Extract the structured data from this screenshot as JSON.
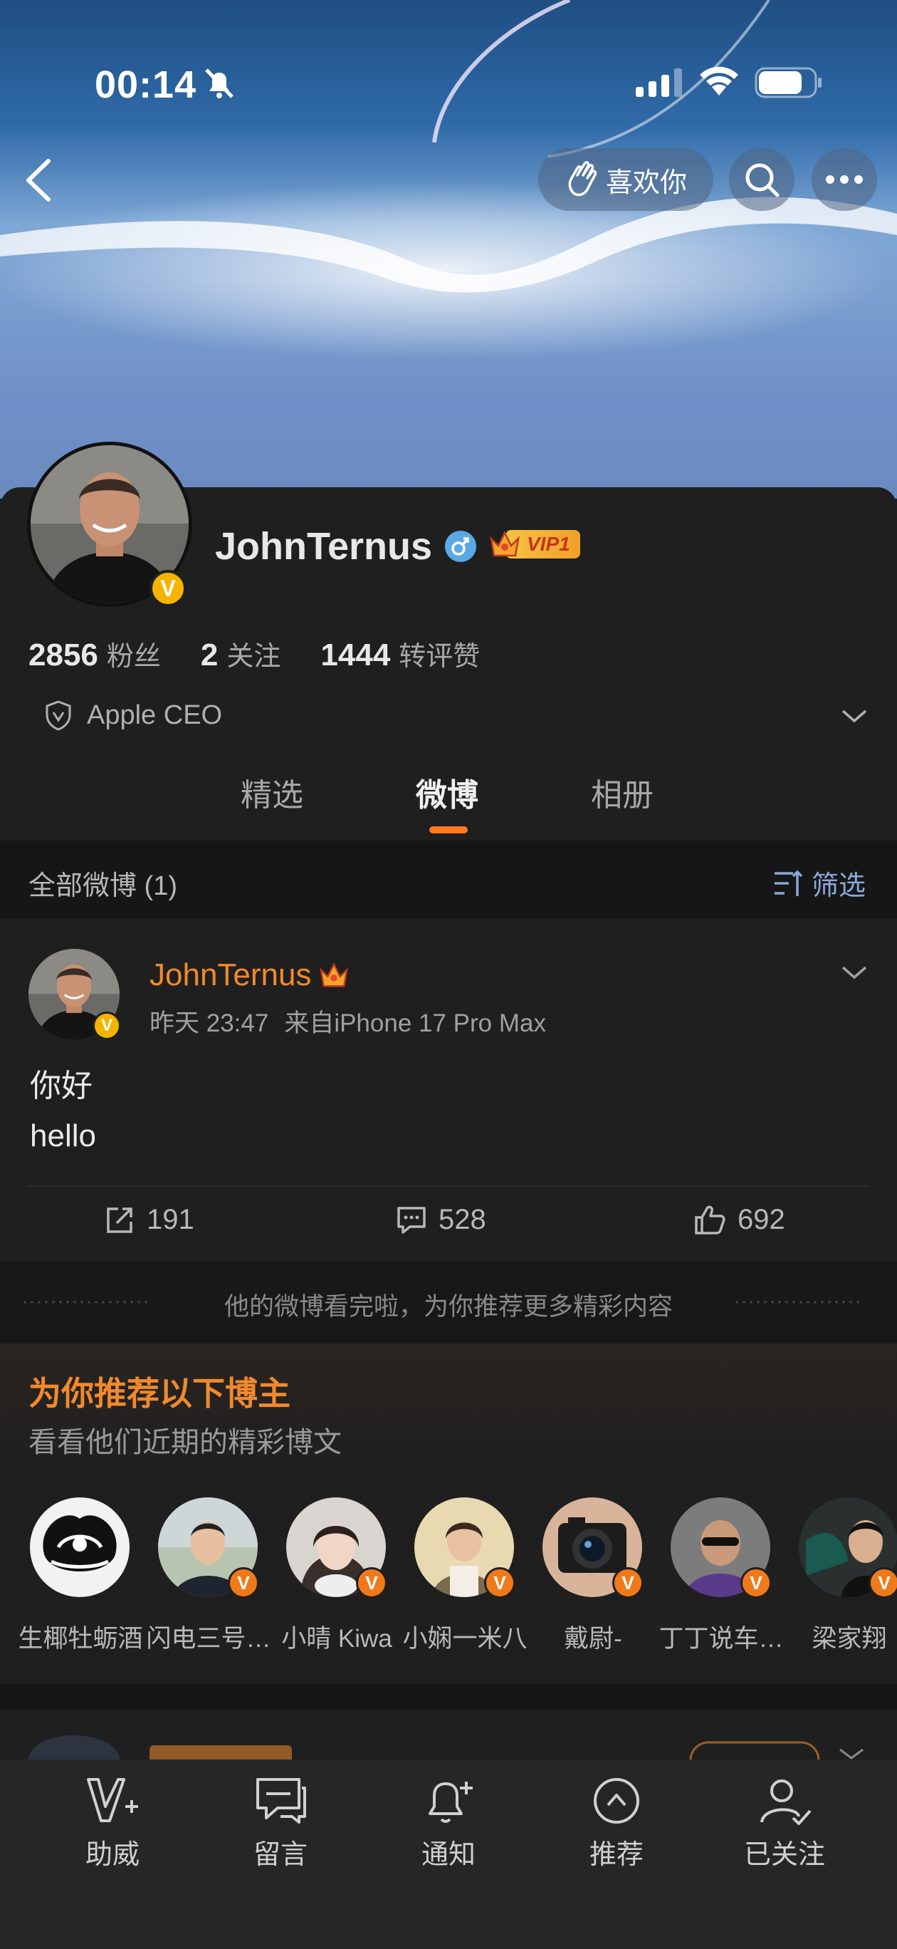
{
  "status_bar": {
    "time": "00:14"
  },
  "header": {
    "like_label": "喜欢你"
  },
  "profile": {
    "name": "JohnTernus",
    "vip_label": "VIP1",
    "verified_mark": "V",
    "stats": [
      {
        "value": "2856",
        "label": "粉丝"
      },
      {
        "value": "2",
        "label": "关注"
      },
      {
        "value": "1444",
        "label": "转评赞"
      }
    ],
    "bio": "Apple CEO"
  },
  "tabs": [
    {
      "label": "精选",
      "active": false
    },
    {
      "label": "微博",
      "active": true
    },
    {
      "label": "相册",
      "active": false
    }
  ],
  "filter_bar": {
    "all_label": "全部微博 (1)",
    "filter_label": "筛选"
  },
  "post": {
    "author": "JohnTernus",
    "time": "昨天 23:47",
    "source": "来自iPhone 17 Pro Max",
    "text_line1": "你好",
    "text_line2": "hello",
    "reposts": "191",
    "comments": "528",
    "likes": "692"
  },
  "end_message": "他的微博看完啦，为你推荐更多精彩内容",
  "recommend": {
    "title": "为你推荐以下博主",
    "subtitle": "看看他们近期的精彩博文",
    "users": [
      {
        "name": "生椰牡蛎酒",
        "verified": false
      },
      {
        "name": "闪电三号…",
        "verified": true
      },
      {
        "name": "小晴 Kiwa",
        "verified": true
      },
      {
        "name": "小娴一米八",
        "verified": true
      },
      {
        "name": "戴尉-",
        "verified": true
      },
      {
        "name": "丁丁说车…",
        "verified": true
      },
      {
        "name": "梁家翔",
        "verified": true
      }
    ]
  },
  "bottom_bar": [
    {
      "label": "助威",
      "icon": "cheer-v-icon"
    },
    {
      "label": "留言",
      "icon": "message-icon"
    },
    {
      "label": "通知",
      "icon": "bell-plus-icon"
    },
    {
      "label": "推荐",
      "icon": "recommend-icon"
    },
    {
      "label": "已关注",
      "icon": "followed-icon"
    }
  ],
  "colors": {
    "accent": "#ff7a1a",
    "name_orange": "#f08a2c",
    "background": "#1f1f1f"
  }
}
